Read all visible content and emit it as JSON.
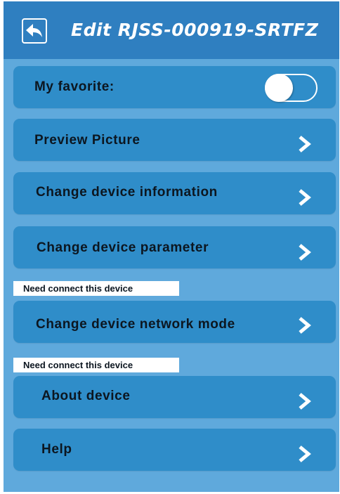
{
  "header": {
    "title": "Edit RJSS-000919-SRTFZ",
    "back_icon": "back-arrow-icon"
  },
  "favorite": {
    "label": "My favorite:",
    "enabled": false
  },
  "menu": [
    {
      "id": "preview-picture",
      "label": "Preview Picture"
    },
    {
      "id": "change-device-information",
      "label": "Change device information"
    },
    {
      "id": "change-device-parameter",
      "label": "Change device parameter"
    },
    {
      "id": "change-device-network-mode",
      "label": "Change device network mode"
    },
    {
      "id": "about-device",
      "label": "About device"
    },
    {
      "id": "help",
      "label": "Help"
    }
  ],
  "notes": {
    "network_mode": "Need connect this device",
    "about_device": "Need connect this device"
  },
  "colors": {
    "header": "#2f7fc0",
    "background": "#5fa9dc",
    "card": "#2f8dc9",
    "text": "#0c1620"
  }
}
